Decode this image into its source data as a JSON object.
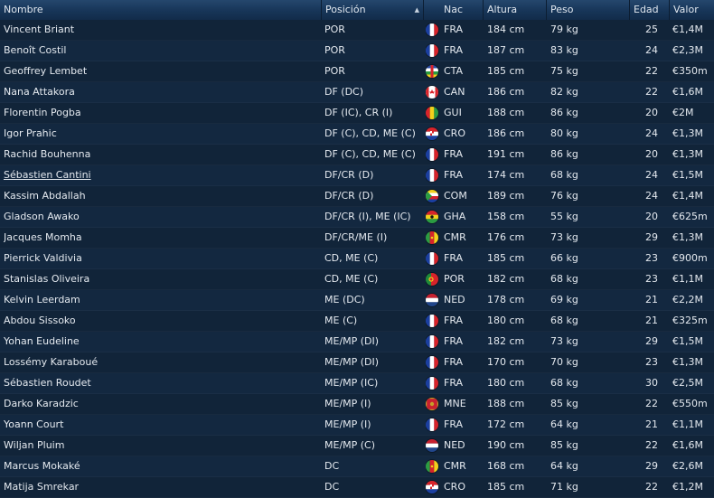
{
  "columns": {
    "nombre": "Nombre",
    "posicion": "Posición",
    "nac": "Nac",
    "altura": "Altura",
    "peso": "Peso",
    "edad": "Edad",
    "valor": "Valor"
  },
  "sort_glyph": "▲",
  "flag_icons": {
    "FRA": "france-flag-icon",
    "CTA": "central-african-republic-flag-icon",
    "CAN": "canada-flag-icon",
    "GUI": "guinea-flag-icon",
    "CRO": "croatia-flag-icon",
    "COM": "comoros-flag-icon",
    "GHA": "ghana-flag-icon",
    "CMR": "cameroon-flag-icon",
    "POR": "portugal-flag-icon",
    "NED": "netherlands-flag-icon",
    "MNE": "montenegro-flag-icon"
  },
  "players": [
    {
      "name": "Vincent Briant",
      "pos": "POR",
      "nac": "FRA",
      "altura": "184 cm",
      "peso": "79 kg",
      "edad": "25",
      "valor": "€1,4M"
    },
    {
      "name": "Benoît Costil",
      "pos": "POR",
      "nac": "FRA",
      "altura": "187 cm",
      "peso": "83 kg",
      "edad": "24",
      "valor": "€2,3M"
    },
    {
      "name": "Geoffrey Lembet",
      "pos": "POR",
      "nac": "CTA",
      "altura": "185 cm",
      "peso": "75 kg",
      "edad": "22",
      "valor": "€350m"
    },
    {
      "name": "Nana Attakora",
      "pos": "DF (DC)",
      "nac": "CAN",
      "altura": "186 cm",
      "peso": "82 kg",
      "edad": "22",
      "valor": "€1,6M"
    },
    {
      "name": "Florentin Pogba",
      "pos": "DF (IC), CR (I)",
      "nac": "GUI",
      "altura": "188 cm",
      "peso": "86 kg",
      "edad": "20",
      "valor": "€2M"
    },
    {
      "name": "Igor Prahic",
      "pos": "DF (C), CD, ME (C)",
      "nac": "CRO",
      "altura": "186 cm",
      "peso": "80 kg",
      "edad": "24",
      "valor": "€1,3M"
    },
    {
      "name": "Rachid Bouhenna",
      "pos": "DF (C), CD, ME (C)",
      "nac": "FRA",
      "altura": "191 cm",
      "peso": "86 kg",
      "edad": "20",
      "valor": "€1,3M"
    },
    {
      "name": "Sébastien Cantini",
      "pos": "DF/CR (D)",
      "nac": "FRA",
      "altura": "174 cm",
      "peso": "68 kg",
      "edad": "24",
      "valor": "€1,5M",
      "underlined": true
    },
    {
      "name": "Kassim Abdallah",
      "pos": "DF/CR (D)",
      "nac": "COM",
      "altura": "189 cm",
      "peso": "76 kg",
      "edad": "24",
      "valor": "€1,4M"
    },
    {
      "name": "Gladson Awako",
      "pos": "DF/CR (I), ME (IC)",
      "nac": "GHA",
      "altura": "158 cm",
      "peso": "55 kg",
      "edad": "20",
      "valor": "€625m"
    },
    {
      "name": "Jacques Momha",
      "pos": "DF/CR/ME (I)",
      "nac": "CMR",
      "altura": "176 cm",
      "peso": "73 kg",
      "edad": "29",
      "valor": "€1,3M"
    },
    {
      "name": "Pierrick Valdivia",
      "pos": "CD, ME (C)",
      "nac": "FRA",
      "altura": "185 cm",
      "peso": "66 kg",
      "edad": "23",
      "valor": "€900m"
    },
    {
      "name": "Stanislas Oliveira",
      "pos": "CD, ME (C)",
      "nac": "POR",
      "altura": "182 cm",
      "peso": "68 kg",
      "edad": "23",
      "valor": "€1,1M"
    },
    {
      "name": "Kelvin Leerdam",
      "pos": "ME (DC)",
      "nac": "NED",
      "altura": "178 cm",
      "peso": "69 kg",
      "edad": "21",
      "valor": "€2,2M"
    },
    {
      "name": "Abdou Sissoko",
      "pos": "ME (C)",
      "nac": "FRA",
      "altura": "180 cm",
      "peso": "68 kg",
      "edad": "21",
      "valor": "€325m"
    },
    {
      "name": "Yohan Eudeline",
      "pos": "ME/MP (DI)",
      "nac": "FRA",
      "altura": "182 cm",
      "peso": "73 kg",
      "edad": "29",
      "valor": "€1,5M"
    },
    {
      "name": "Lossémy Karaboué",
      "pos": "ME/MP (DI)",
      "nac": "FRA",
      "altura": "170 cm",
      "peso": "70 kg",
      "edad": "23",
      "valor": "€1,3M"
    },
    {
      "name": "Sébastien Roudet",
      "pos": "ME/MP (IC)",
      "nac": "FRA",
      "altura": "180 cm",
      "peso": "68 kg",
      "edad": "30",
      "valor": "€2,5M"
    },
    {
      "name": "Darko Karadzic",
      "pos": "ME/MP (I)",
      "nac": "MNE",
      "altura": "188 cm",
      "peso": "85 kg",
      "edad": "22",
      "valor": "€550m"
    },
    {
      "name": "Yoann Court",
      "pos": "ME/MP (I)",
      "nac": "FRA",
      "altura": "172 cm",
      "peso": "64 kg",
      "edad": "21",
      "valor": "€1,1M"
    },
    {
      "name": "Wiljan Pluim",
      "pos": "ME/MP (C)",
      "nac": "NED",
      "altura": "190 cm",
      "peso": "85 kg",
      "edad": "22",
      "valor": "€1,6M"
    },
    {
      "name": "Marcus Mokaké",
      "pos": "DC",
      "nac": "CMR",
      "altura": "168 cm",
      "peso": "64 kg",
      "edad": "29",
      "valor": "€2,6M"
    },
    {
      "name": "Matija Smrekar",
      "pos": "DC",
      "nac": "CRO",
      "altura": "185 cm",
      "peso": "71 kg",
      "edad": "22",
      "valor": "€1,2M"
    }
  ]
}
